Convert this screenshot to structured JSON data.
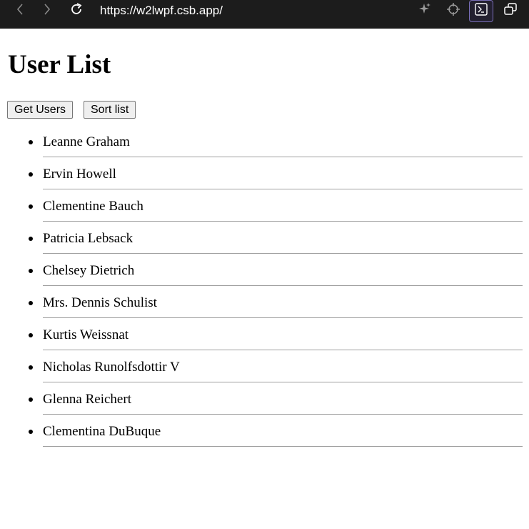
{
  "browser": {
    "url": "https://w2lwpf.csb.app/",
    "icons": [
      "back-icon",
      "forward-icon",
      "reload-icon",
      "sparkle-icon",
      "crosshair-icon",
      "terminal-icon",
      "open-external-icon"
    ]
  },
  "page": {
    "title": "User List",
    "buttons": {
      "get_users": "Get Users",
      "sort_list": "Sort list"
    },
    "users": [
      "Leanne Graham",
      "Ervin Howell",
      "Clementine Bauch",
      "Patricia Lebsack",
      "Chelsey Dietrich",
      "Mrs. Dennis Schulist",
      "Kurtis Weissnat",
      "Nicholas Runolfsdottir V",
      "Glenna Reichert",
      "Clementina DuBuque"
    ]
  }
}
